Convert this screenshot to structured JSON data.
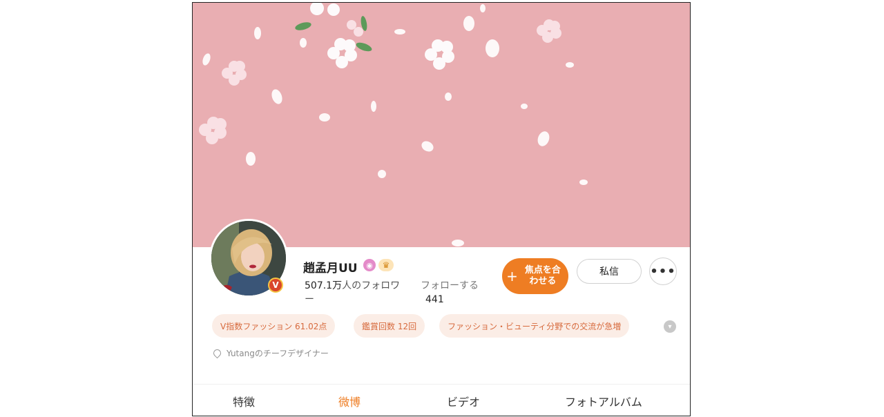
{
  "profile": {
    "name": "趙孟月UU",
    "verified_badge": "V",
    "followers_count": "507.1万",
    "followers_label": "人のフォロワー",
    "following_label": "フォローする",
    "following_count": "441",
    "bio": "Yutangのチーフデザイナー"
  },
  "actions": {
    "follow_label": "焦点を合わせる",
    "follow_plus": "+",
    "message_label": "私信",
    "more_label": "•••"
  },
  "tags": [
    "V指数ファッション 61.02点",
    "鑑賞回数 12回",
    "ファッション・ビューティ分野での交流が急増"
  ],
  "tabs": [
    "特徴",
    "微博",
    "ビデオ",
    "フォトアルバム"
  ],
  "active_tab": "微博",
  "colors": {
    "banner": "#e9aeb2",
    "accent": "#ee7d23",
    "tag_bg": "#fbede6",
    "tag_text": "#d76a3d"
  },
  "icons": {
    "verified": "v-badge-icon",
    "name_badge_1": "purple-circle-icon",
    "name_badge_2": "crown-icon",
    "more": "ellipsis-icon",
    "tags_more": "chevron-down-icon",
    "bio": "location-pin-icon"
  }
}
